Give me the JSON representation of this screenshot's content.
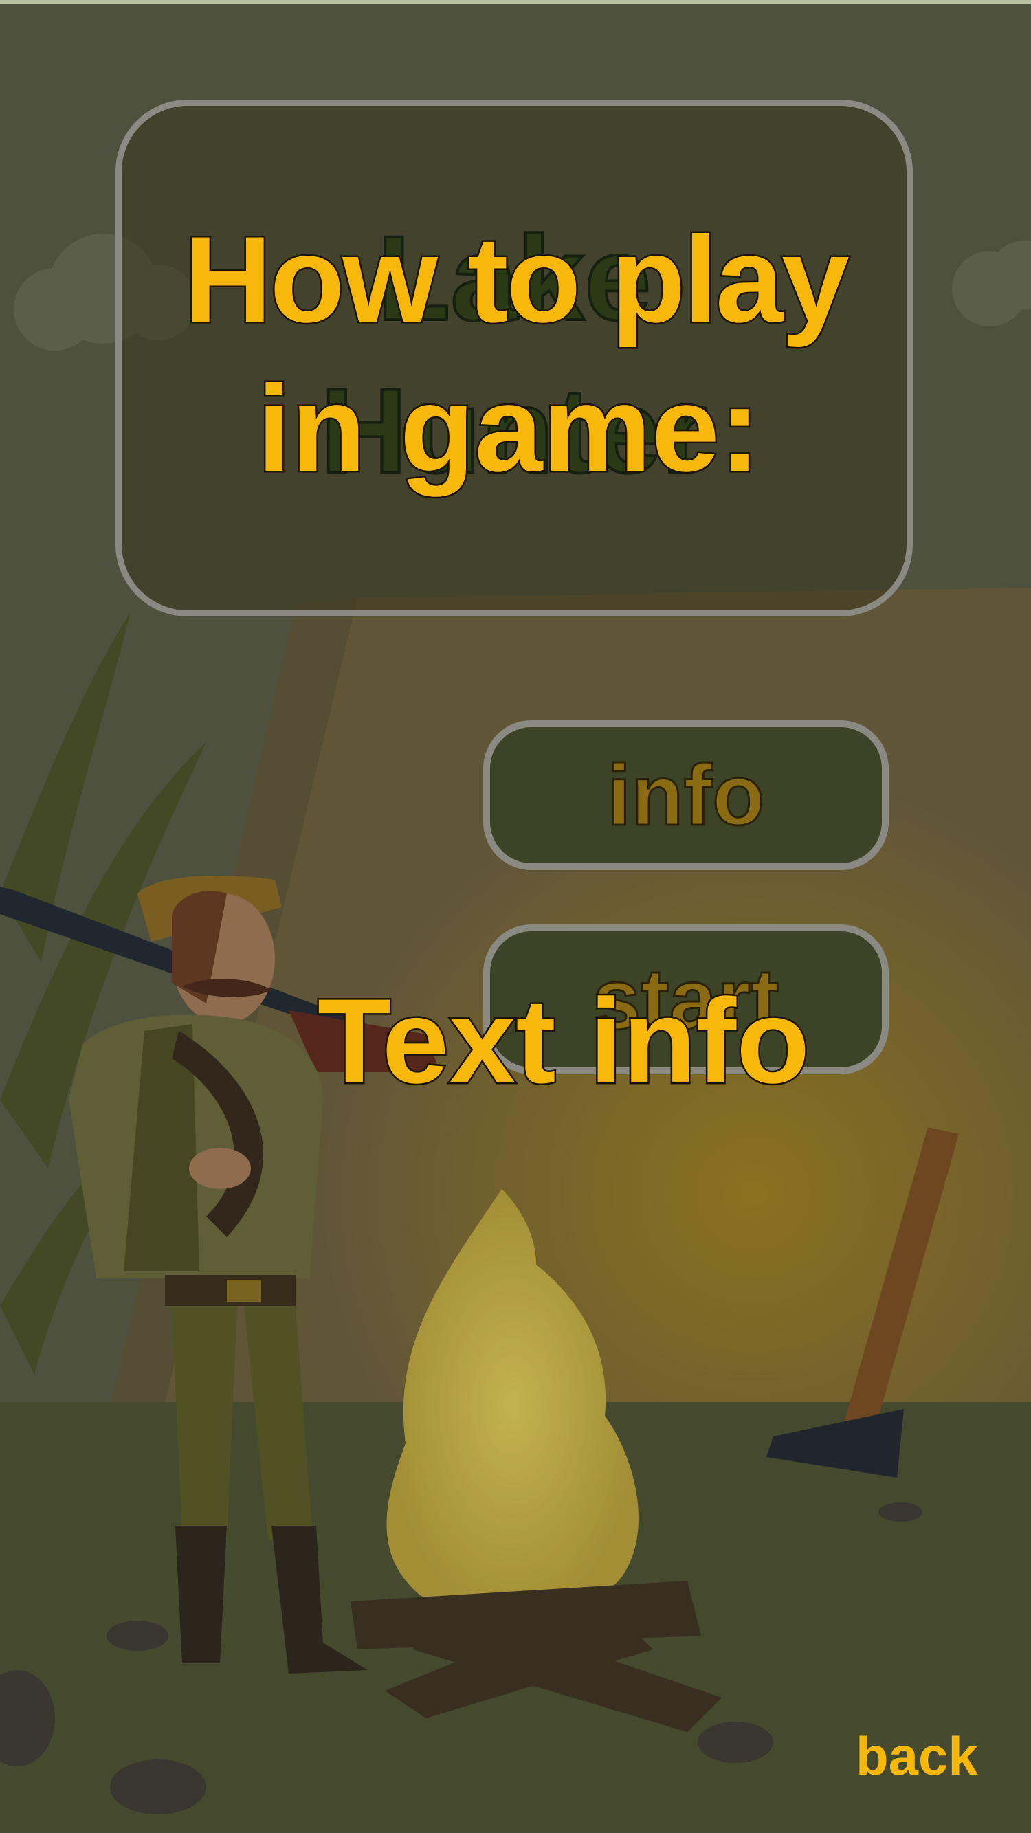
{
  "background": {
    "colors": {
      "sky": "#555a45",
      "tent": "#6e5e40",
      "ground": "#4b5133",
      "heading": "#f7b70b"
    }
  },
  "menu": {
    "title_line1": "Lake",
    "title_line2": "Hunter",
    "info_label": "info",
    "start_label": "start"
  },
  "overlay": {
    "heading_line1": "How to play",
    "heading_line2": "in game:",
    "body_text": "Text info",
    "back_label": "back"
  }
}
